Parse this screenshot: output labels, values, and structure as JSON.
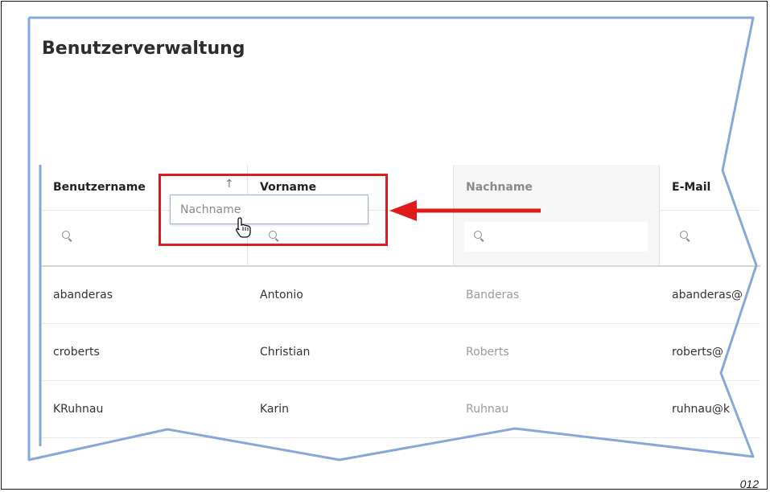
{
  "page": {
    "title": "Benutzerverwaltung"
  },
  "columns": [
    {
      "label": "Benutzername",
      "muted": false
    },
    {
      "label": "Vorname",
      "muted": false
    },
    {
      "label": "Nachname",
      "muted": true
    },
    {
      "label": "E-Mail",
      "muted": false
    }
  ],
  "sort_indicator": "↑",
  "rows": [
    {
      "username": "abanderas",
      "firstname": "Antonio",
      "lastname": "Banderas",
      "email": "abanderas@"
    },
    {
      "username": "croberts",
      "firstname": "Christian",
      "lastname": "Roberts",
      "email": "roberts@"
    },
    {
      "username": "KRuhnau",
      "firstname": "Karin",
      "lastname": "Ruhnau",
      "email": "ruhnau@k"
    }
  ],
  "drag_ghost": {
    "label": "Nachname"
  },
  "colors": {
    "highlight": "#e01b1b",
    "torn_edge": "#86a8d8"
  },
  "figure_number": "012"
}
